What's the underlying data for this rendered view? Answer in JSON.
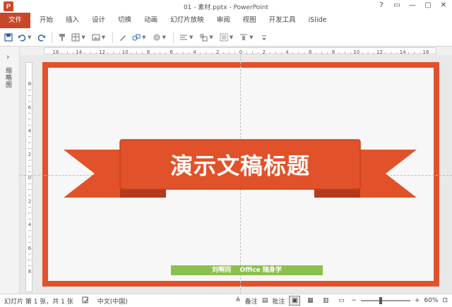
{
  "window": {
    "title": "01 - 素材.pptx - PowerPoint",
    "app_icon": "P",
    "buttons": [
      "?",
      "▭",
      "—",
      "▢",
      "✕"
    ]
  },
  "tabs": [
    "文件",
    "开始",
    "插入",
    "设计",
    "切换",
    "动画",
    "幻灯片放映",
    "审阅",
    "视图",
    "开发工具",
    "iSlide"
  ],
  "toolbar_icons": [
    "save-icon",
    "undo-icon",
    "redo-icon",
    "format-painter-icon",
    "table-icon",
    "picture-icon",
    "shape-icon",
    "align-icon",
    "group-icon",
    "more-icon"
  ],
  "left_pane": {
    "label": "缩略图"
  },
  "rulers": {
    "horizontal": [
      "16",
      "14",
      "12",
      "10",
      "8",
      "6",
      "4",
      "2",
      "0",
      "2",
      "4",
      "6",
      "8",
      "10",
      "12",
      "14",
      "16"
    ],
    "vertical": [
      "8",
      "6",
      "4",
      "2",
      "0",
      "2",
      "4",
      "6",
      "8"
    ]
  },
  "slide": {
    "title": "演示文稿标题",
    "credit": "刘啊同    Office 随身学",
    "colors": {
      "border": "#e2522a",
      "ribbon_dark": "#c8401c",
      "background": "#f7f7f7",
      "credit_bg": "#8cc04d"
    }
  },
  "statusbar": {
    "slide_info": "幻灯片 第 1 张，共 1 张",
    "language": "中文(中国)",
    "notes": "备注",
    "comments": "批注",
    "zoom": "60%"
  }
}
